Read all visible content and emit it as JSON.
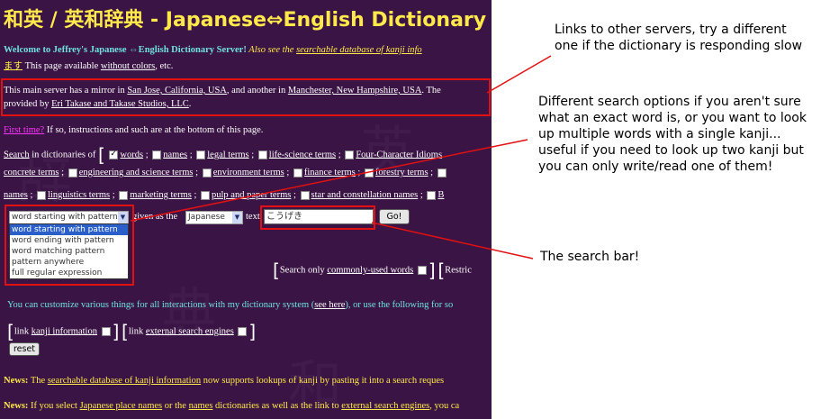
{
  "title": "和英 / 英和辞典 - Japanese⇔English Dictionary",
  "welcome": {
    "bold": "Welcome to Jeffrey's Japanese ⇔English Dictionary Server!",
    "italic": " Also see the ",
    "link": "searchable database of kanji info",
    "line2_link": "ます",
    "line2_text": " This page available ",
    "line2_link2": "without colors",
    "line2_end": ", etc."
  },
  "mirror": {
    "t1": "This main server has a mirror in ",
    "l1": "San Jose, California, USA",
    "t2": ", and another in ",
    "l2": "Manchester, New Hampshire, USA",
    "t3": ". The",
    "t4": "provided by ",
    "l3": "Eri Takase and Takase Studios, LLC",
    "t5": "."
  },
  "firsttime": {
    "link": "First time?",
    "text": " If so, instructions and such are at the bottom of this page."
  },
  "search": {
    "search_link": "Search",
    "in_dicts": " in dictionaries of ",
    "dicts_row1": [
      "words",
      "names",
      "legal terms",
      "life-science terms",
      "Four-Character Idioms"
    ],
    "dicts_row2": [
      "concrete terms",
      "engineering and science terms",
      "environment terms",
      "finance terms",
      "forestry terms"
    ],
    "dicts_row3": [
      "names",
      "linguistics terms",
      "marketing terms",
      "pulp and paper terms",
      "star and constellation names",
      "B"
    ],
    "mode_value": "word starting with pattern",
    "mode_options": [
      "word starting with pattern",
      "word ending with pattern",
      "word matching pattern",
      "pattern anywhere",
      "full regular expression"
    ],
    "given_as": "given as the",
    "lang_value": "Japanese",
    "text_label": "text",
    "query_value": "こうげき",
    "go_label": "Go!",
    "common_prefix": "Search only ",
    "common_link": "commonly-used words",
    "restrict": "Restric"
  },
  "customize": {
    "t1": "You can customize various things for all interactions with my dictionary system (",
    "link": "see here",
    "t2": "), or use the following for so"
  },
  "links_opts": {
    "link_word": "link",
    "kanji": "kanji information",
    "ext": "external search engines"
  },
  "reset_label": "reset",
  "news": [
    {
      "label": "News:",
      "t1": " The ",
      "link": "searchable database of kanji information",
      "t2": " now supports lookups of kanji by pasting it into a search reques"
    },
    {
      "label": "News:",
      "t1": " If you select ",
      "link": "Japanese place names",
      "t2": " or the ",
      "link2": "names",
      "t3": " dictionaries as well as the link to ",
      "link3": "external search engines",
      "t4": ", you ca"
    }
  ],
  "annotations": {
    "servers": "Links to other servers, try a different one if the dictionary is responding slow",
    "options": "Different search options if you aren't sure what an exact word is, or you want to look up multiple words with a single kanji... useful if you need to look up two kanji but you can only write/read one of them!",
    "searchbar": "The search bar!"
  },
  "colors": {
    "page_bg": "#3a1444",
    "title": "#ffe94a",
    "highlight": "#e21010"
  }
}
